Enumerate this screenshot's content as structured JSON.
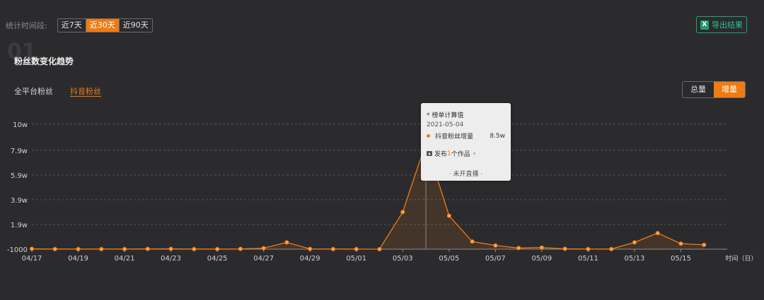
{
  "filter": {
    "label": "统计时间段:",
    "options": [
      "近7天",
      "近30天",
      "近90天"
    ],
    "selected": "近30天"
  },
  "export": {
    "label": "导出结果",
    "icon": "excel-icon"
  },
  "section": {
    "number": "01",
    "title": "粉丝数变化趋势"
  },
  "platform_tabs": [
    {
      "label": "全平台粉丝",
      "active": false
    },
    {
      "label": "抖音粉丝",
      "active": true
    }
  ],
  "mode": {
    "options": [
      "总量",
      "增量"
    ],
    "selected": "增量"
  },
  "tooltip": {
    "title": "* 榜单计算值",
    "date": "2021-05-04",
    "series_name": "抖音粉丝增量",
    "value": "8.5w",
    "works_prefix": "发布",
    "works_count": "1",
    "works_suffix": "个作品",
    "live": "· 未开直播 ·"
  },
  "colors": {
    "accent": "#f07b12",
    "background": "#2b2b2e",
    "export": "#2ec38f"
  },
  "chart_data": {
    "type": "area",
    "series": [
      {
        "name": "抖音粉丝增量",
        "x": [
          "04/17",
          "04/18",
          "04/19",
          "04/20",
          "04/21",
          "04/22",
          "04/23",
          "04/24",
          "04/25",
          "04/26",
          "04/27",
          "04/28",
          "04/29",
          "04/30",
          "05/01",
          "05/02",
          "05/03",
          "05/04",
          "05/05",
          "05/06",
          "05/07",
          "05/08",
          "05/09",
          "05/10",
          "05/11",
          "05/12",
          "05/13",
          "05/14",
          "05/15",
          "05/16"
        ],
        "values": [
          -700,
          -900,
          -900,
          -900,
          -900,
          -800,
          -700,
          -900,
          -900,
          -800,
          -200,
          4500,
          -800,
          -900,
          -900,
          -1000,
          29000,
          85000,
          26000,
          5200,
          2000,
          -100,
          300,
          -700,
          -900,
          -900,
          4500,
          12000,
          3500,
          2500
        ]
      }
    ],
    "x_tick_labels": [
      "04/17",
      "04/19",
      "04/21",
      "04/23",
      "04/25",
      "04/27",
      "04/29",
      "05/01",
      "05/03",
      "05/05",
      "05/07",
      "05/09",
      "05/11",
      "05/13",
      "05/15"
    ],
    "y_ticks": [
      -1000,
      19000,
      39000,
      59000,
      79000,
      100000
    ],
    "y_tick_labels": [
      "-1000",
      "1.9w",
      "3.9w",
      "5.9w",
      "7.9w",
      "10w"
    ],
    "ylim": [
      -1000,
      100000
    ],
    "xlabel": "时间（日）",
    "grid": true,
    "highlight_x": "05/04"
  }
}
